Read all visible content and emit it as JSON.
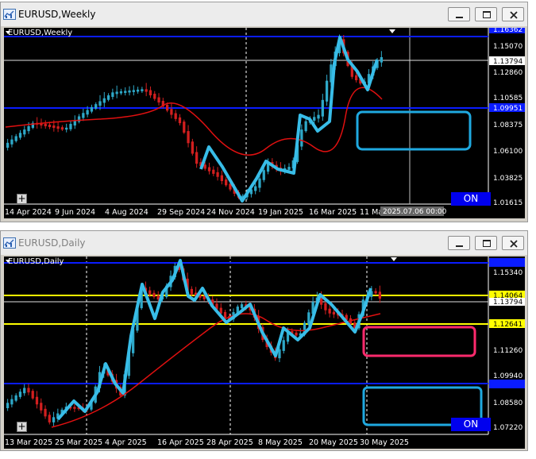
{
  "weekly": {
    "window_title": "EURUSD,Weekly",
    "chart_label": "EURUSD,Weekly",
    "on_button": "ON",
    "price_labels": [
      "1.16362",
      "1.15070",
      "1.13794",
      "1.12860",
      "1.10585",
      "1.09951",
      "1.08375",
      "1.06100",
      "1.03825",
      "1.01615"
    ],
    "time_labels": [
      "14 Apr 2024",
      "9 Jun 2024",
      "4 Aug 2024",
      "29 Sep 2024",
      "24 Nov 2024",
      "19 Jan 2025",
      "16 Mar 2025",
      "11 Ma"
    ],
    "crosshair_time": "2025.07.06 00:00",
    "colors": {
      "bull": "#2ea8c8",
      "bear": "#d21f1f",
      "ma": "#e01010",
      "zigzag": "#38bde8",
      "hline": "#0a1cff",
      "box": "#1fa9e0"
    }
  },
  "daily": {
    "window_title": "EURUSD,Daily",
    "chart_label": "EURUSD,Daily",
    "on_button": "ON",
    "price_labels": [
      "1.15340",
      "1.14064",
      "1.13794",
      "1.12641",
      "1.11260",
      "1.09940",
      "1.08580",
      "1.07220"
    ],
    "time_labels": [
      "13 Mar 2025",
      "25 Mar 2025",
      "4 Apr 2025",
      "16 Apr 2025",
      "28 Apr 2025",
      "8 May 2025",
      "20 May 2025",
      "30 May 2025"
    ],
    "colors": {
      "bull": "#2ea8c8",
      "bear": "#d21f1f",
      "ma": "#e01010",
      "zigzag": "#38bde8",
      "hline": "#0a1cff",
      "yline": "#ffff00",
      "box_pink": "#ff2a6d",
      "box_blue": "#1fa9e0"
    }
  }
}
